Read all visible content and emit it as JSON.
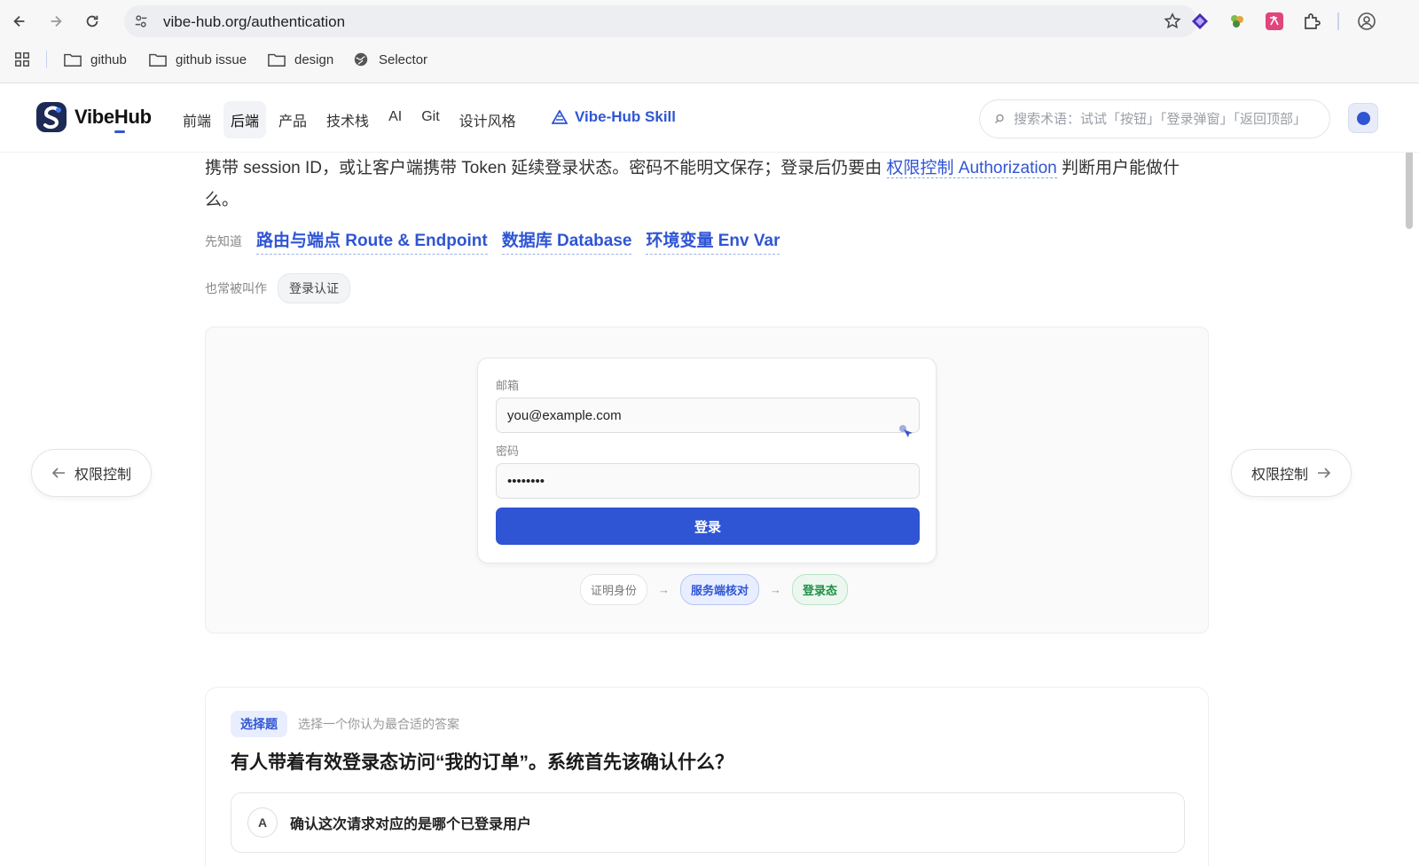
{
  "browser": {
    "url": "vibe-hub.org/authentication",
    "bookmarks": [
      "github",
      "github issue",
      "design",
      "Selector"
    ],
    "icons": [
      "back-icon",
      "forward-icon",
      "reload-icon",
      "site-settings-icon",
      "bookmark-star-icon",
      "extension-icon",
      "profile-icon",
      "apps-grid-icon"
    ]
  },
  "site": {
    "brand": "VibeHub",
    "nav": [
      "前端",
      "后端",
      "产品",
      "技术栈",
      "AI",
      "Git",
      "设计风格"
    ],
    "active_nav": "后端",
    "skill_label": "Vibe-Hub Skill",
    "search_placeholder": "搜索术语：试试「按钮」「登录弹窗」「返回顶部」",
    "accent_color": "#2f55d4"
  },
  "article": {
    "para_part1": "携带 session ID，或让客户端携带 Token 延续登录状态。密码不能明文保存；登录后仍要由 ",
    "para_link": "权限控制 Authorization",
    "para_part2": " 判断用户能做什么。",
    "prereq_label": "先知道",
    "prereqs": [
      "路由与端点 Route & Endpoint",
      "数据库 Database",
      "环境变量 Env Var"
    ],
    "aka_label": "也常被叫作",
    "aka_chip": "登录认证"
  },
  "demo": {
    "email_label": "邮箱",
    "email_value": "you@example.com",
    "password_label": "密码",
    "password_value": "••••••••",
    "login_button": "登录",
    "flow_steps": [
      "证明身份",
      "服务端核对",
      "登录态"
    ],
    "flow_arrow": "→"
  },
  "pager": {
    "prev": "权限控制",
    "next": "权限控制"
  },
  "quiz": {
    "badge": "选择题",
    "hint": "选择一个你认为最合适的答案",
    "question": "有人带着有效登录态访问“我的订单”。系统首先该确认什么？",
    "options": [
      {
        "key": "A",
        "text": "确认这次请求对应的是哪个已登录用户"
      }
    ]
  }
}
